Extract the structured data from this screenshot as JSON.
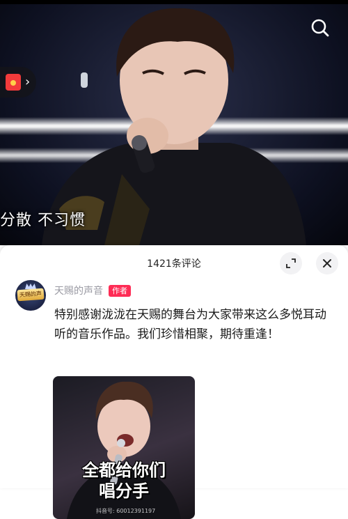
{
  "video": {
    "subtitle": "分散  不习惯",
    "icons": {
      "search": "search-icon",
      "red_packet": "red-packet-icon",
      "entry_arrow": "chevron-right-icon"
    }
  },
  "comments_panel": {
    "title": "1421条评论",
    "icons": {
      "expand": "expand-icon",
      "close": "close-icon"
    },
    "comment": {
      "username": "天赐的声音",
      "badge": "作者",
      "avatar_text": "天赐的声音",
      "text": "特别感谢泷泷在天赐的舞台为大家带来这么多悦耳动听的音乐作品。我们珍惜相聚，期待重逢！",
      "sticker": {
        "caption_line1": "全都给你们",
        "caption_line2": "唱分手",
        "watermark": "抖音号: 60012391197"
      }
    }
  },
  "colors": {
    "accent": "#fe2c55",
    "sheet_bg": "#ffffff",
    "username": "#9a9aa3"
  }
}
